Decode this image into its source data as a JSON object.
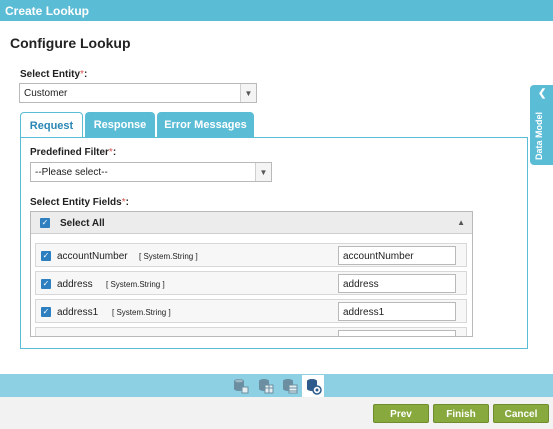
{
  "window": {
    "title": "Create Lookup"
  },
  "page": {
    "title": "Configure Lookup"
  },
  "entity": {
    "label": "Select Entity",
    "required_mark": "*",
    "colon": ":",
    "value": "Customer"
  },
  "tabs": [
    {
      "label": "Request",
      "active": true
    },
    {
      "label": "Response",
      "active": false
    },
    {
      "label": "Error Messages",
      "active": false
    }
  ],
  "filter": {
    "label": "Predefined Filter",
    "required_mark": "*",
    "colon": ":",
    "value": "--Please select--"
  },
  "fields": {
    "label": "Select Entity Fields",
    "required_mark": "*",
    "colon": ":",
    "select_all": "Select All",
    "rows": [
      {
        "name": "accountNumber",
        "type": "[ System.String ]",
        "value": "accountNumber"
      },
      {
        "name": "address",
        "type": "[ System.String ]",
        "value": "address"
      },
      {
        "name": "address1",
        "type": "[ System.String ]",
        "value": "address1"
      }
    ]
  },
  "side_panel": {
    "label": "Data Model"
  },
  "footer": {
    "prev": "Prev",
    "finish": "Finish",
    "cancel": "Cancel"
  },
  "colors": {
    "header": "#5bbcd6",
    "button": "#88a93d",
    "checkbox": "#2e7fbf",
    "required": "#d9534f"
  },
  "icons": [
    "database-icon",
    "database-table-icon",
    "database-table-icon",
    "database-settings-icon"
  ]
}
